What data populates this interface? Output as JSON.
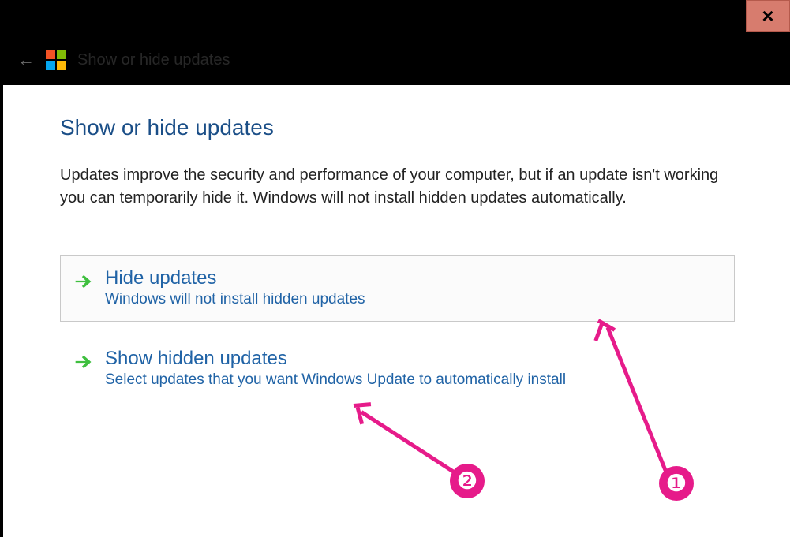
{
  "close_label": "×",
  "titlebar": {
    "title": "Show or hide updates"
  },
  "heading": "Show or hide updates",
  "description": "Updates improve the security and performance of your computer, but if an update isn't working you can temporarily hide it. Windows will not install hidden updates automatically.",
  "options": [
    {
      "title": "Hide updates",
      "subtitle": "Windows will not install hidden updates"
    },
    {
      "title": "Show hidden updates",
      "subtitle": "Select updates that you want Windows Update to automatically install"
    }
  ],
  "annotations": {
    "one": "❶",
    "two": "❷"
  }
}
